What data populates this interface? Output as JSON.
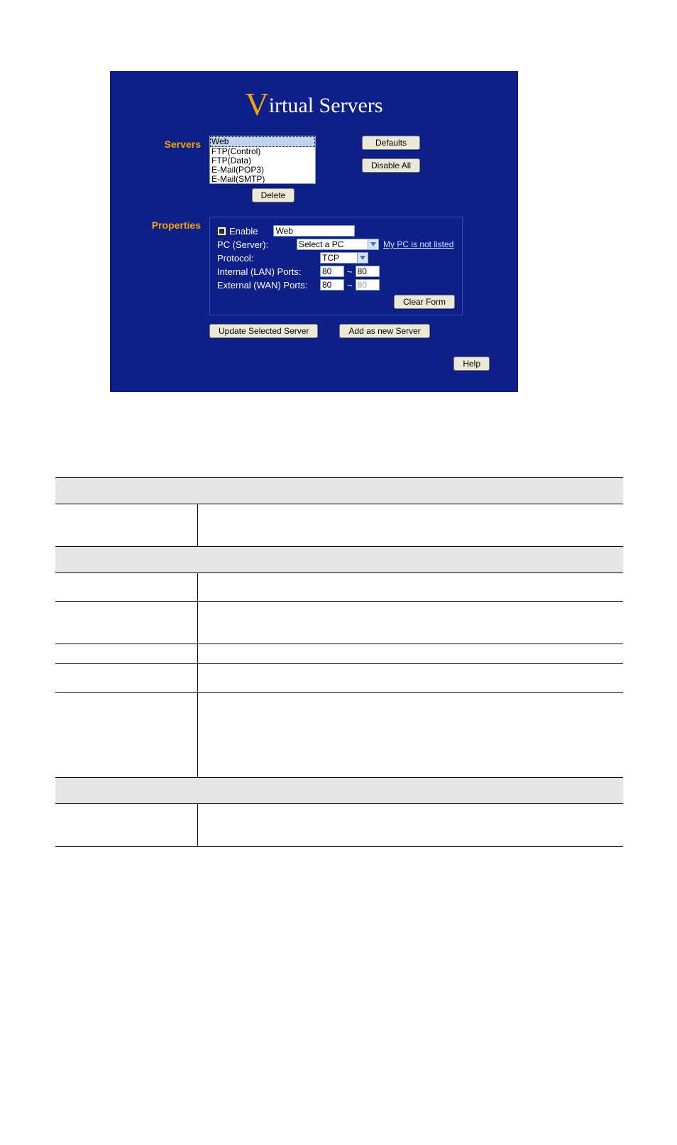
{
  "page_title": {
    "cap": "V",
    "rest": "irtual Servers"
  },
  "sections": {
    "servers_label": "Servers",
    "properties_label": "Properties"
  },
  "servers": {
    "items": [
      "Web",
      "FTP(Control)",
      "FTP(Data)",
      "E-Mail(POP3)",
      "E-Mail(SMTP)"
    ],
    "selected_index": 0,
    "defaults_btn": "Defaults",
    "disable_all_btn": "Disable All",
    "delete_btn": "Delete"
  },
  "properties": {
    "enable_label": "Enable",
    "enable_checked": true,
    "name_value": "Web",
    "pc_label": "PC (Server):",
    "pc_value": "Select a PC",
    "my_pc_link": "My PC is not listed",
    "protocol_label": "Protocol:",
    "protocol_value": "TCP",
    "lan_label": "Internal (LAN) Ports:",
    "lan_from": "80",
    "lan_to": "80",
    "wan_label": "External (WAN) Ports:",
    "wan_from": "80",
    "wan_to": "80",
    "tilde": "~",
    "clear_btn": "Clear Form",
    "update_btn": "Update Selected Server",
    "add_btn": "Add as new Server",
    "help_btn": "Help"
  },
  "table": {
    "groups": [
      {
        "header": "",
        "rows": [
          [
            "",
            ""
          ]
        ]
      },
      {
        "header": "",
        "rows": [
          [
            "",
            ""
          ],
          [
            "",
            ""
          ],
          [
            "",
            ""
          ],
          [
            "",
            ""
          ],
          [
            "",
            ""
          ]
        ]
      },
      {
        "header": "",
        "rows": [
          [
            "",
            ""
          ]
        ]
      }
    ]
  }
}
